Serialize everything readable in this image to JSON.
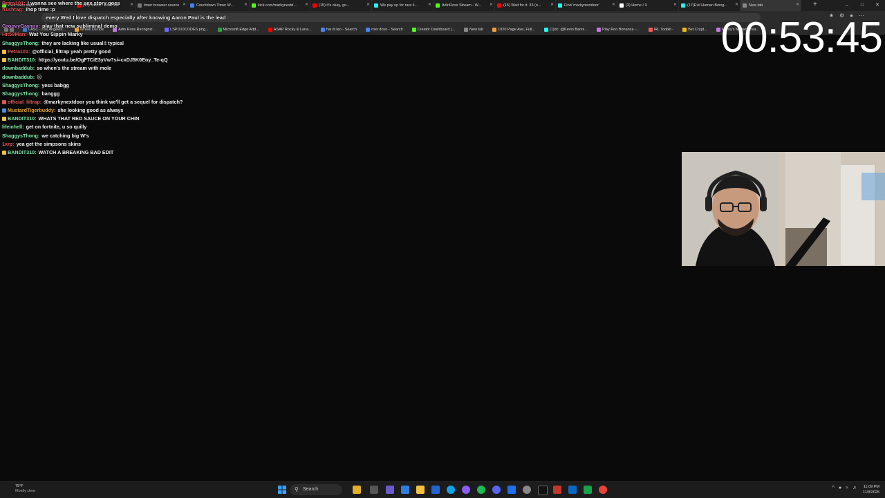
{
  "overlay": {
    "lines": [
      {
        "user": "Petra101:",
        "user_color": "#e05353",
        "text": "I wanna see where the sex story goes"
      },
      {
        "user": "h1shtag:",
        "user_color": "#e05353",
        "text": "ihop time :p"
      },
      {
        "user": "",
        "user_color": "#ff7a7a",
        "text": "every Wed I love dispatch especially after knowing Aaron Paul is the lead"
      },
      {
        "user": "GroovyGranny:",
        "user_color": "#c678dd",
        "text": "play that new subliminal demo"
      },
      {
        "user": "Hit59Man:",
        "user_color": "#e05353",
        "text": "Wat You Sippin Marky"
      }
    ]
  },
  "browser": {
    "tabs": [
      {
        "label": "Kick team says...",
        "color": "#53fc18"
      },
      {
        "label": "(15) Jolina - YouTube",
        "color": "#ff0000"
      },
      {
        "label": "timer browser source",
        "color": "#777777"
      },
      {
        "label": "Countdown Timer W...",
        "color": "#4285f4"
      },
      {
        "label": "kick.com/markynextd...",
        "color": "#53fc18"
      },
      {
        "label": "(15) It's okay, go...",
        "color": "#ff0000"
      },
      {
        "label": "We pay up for rare li...",
        "color": "#25f4ee"
      },
      {
        "label": "AdinRoss Stream - W...",
        "color": "#53fc18"
      },
      {
        "label": "(15) Wait for it. 33 (o...",
        "color": "#ff0000"
      },
      {
        "label": "Find 'markynextdoor'",
        "color": "#25f4ee"
      },
      {
        "label": "(3) Home / X",
        "color": "#ffffff"
      },
      {
        "label": "(17)Evil Human Being...",
        "color": "#25f4ee"
      },
      {
        "label": "New tab",
        "color": "#888888"
      }
    ],
    "bookmarks": [
      {
        "label": "LASC - Los Angeles...",
        "color": "#3a7bd5"
      },
      {
        "label": "Wheel Decide",
        "color": "#e8a33a"
      },
      {
        "label": "Adin Ross Recogniz...",
        "color": "#c678dd"
      },
      {
        "label": "LSPD10CODES.png...",
        "color": "#6a6aff"
      },
      {
        "label": "Microsoft Edge Add...",
        "color": "#2ea043"
      },
      {
        "label": "ASAP Rocky & Lana...",
        "color": "#ff0000"
      },
      {
        "label": "hai di lao - Search",
        "color": "#4285f4"
      },
      {
        "label": "roer dcuo - Search",
        "color": "#4285f4"
      },
      {
        "label": "Creator Dashboard |...",
        "color": "#53fc18"
      },
      {
        "label": "New tab",
        "color": "#888888"
      },
      {
        "label": "1920 Page Ave, Full...",
        "color": "#e8a33a"
      },
      {
        "label": "(1)dc: @Kevin Banni...",
        "color": "#25f4ee"
      },
      {
        "label": "Play Roo Bonanza -...",
        "color": "#c678dd"
      },
      {
        "label": "IRL Toolkit -",
        "color": "#ff5555"
      },
      {
        "label": "Bet Crypt...",
        "color": "#f0b90b"
      },
      {
        "label": "Marky's Market Riva...",
        "color": "#c678dd"
      }
    ]
  },
  "chat": {
    "messages": [
      {
        "user": "ShaggysThong:",
        "user_color": "#7fe6a8",
        "badge": "",
        "text": "they are lacking like usual!! typical"
      },
      {
        "user": "Petra101:",
        "user_color": "#e05353",
        "badge": "#f0c040",
        "text": "@official_liltrap yeah pretty good"
      },
      {
        "user": "BANDIT310:",
        "user_color": "#7fe6a8",
        "badge": "#f0c040",
        "text": "https://youtu.be/OgF7CiE3yVw?si=cxDJ5K0Eoy_Te-qQ"
      },
      {
        "user": "downbaddub:",
        "user_color": "#7fe6a8",
        "badge": "",
        "text": "so when's the stream with mole"
      },
      {
        "user": "downbaddub:",
        "user_color": "#7fe6a8",
        "badge": "",
        "text": "😐"
      },
      {
        "user": "ShaggysThong:",
        "user_color": "#7fe6a8",
        "badge": "",
        "text": "yess babgg"
      },
      {
        "user": "ShaggysThong:",
        "user_color": "#7fe6a8",
        "badge": "",
        "text": "banggg"
      },
      {
        "user": "official_liltrap:",
        "user_color": "#e05353",
        "badge": "#e05353",
        "text": "@markynextdoor you think we'll get a sequel for dispatch?"
      },
      {
        "user": "MustardTigerbuddy:",
        "user_color": "#e0a030",
        "badge": "#4a90e2",
        "text": "she looking good as always"
      },
      {
        "user": "BANDIT310:",
        "user_color": "#7fe6a8",
        "badge": "#f0c040",
        "text": "WHATS THAT RED SAUCE ON YOUR CHIN"
      },
      {
        "user": "lifeinhell:",
        "user_color": "#7fe6a8",
        "badge": "",
        "text": "get on fortnite, u so quilly"
      },
      {
        "user": "ShaggysThong:",
        "user_color": "#7fe6a8",
        "badge": "",
        "text": "we catching big W's"
      },
      {
        "user": "1xrp:",
        "user_color": "#e05353",
        "badge": "",
        "text": "yea get the simpsons skins"
      },
      {
        "user": "BANDIT310:",
        "user_color": "#7fe6a8",
        "badge": "#f0c040",
        "text": "WATCH A BREAKING BAD EDIT"
      }
    ]
  },
  "timer": {
    "value": "00:53:45"
  },
  "taskbar": {
    "weather_temp": "75°F",
    "weather_desc": "Mostly clear",
    "search_label": "Search",
    "time": "11:09 PM",
    "date": "11/3/2025"
  }
}
